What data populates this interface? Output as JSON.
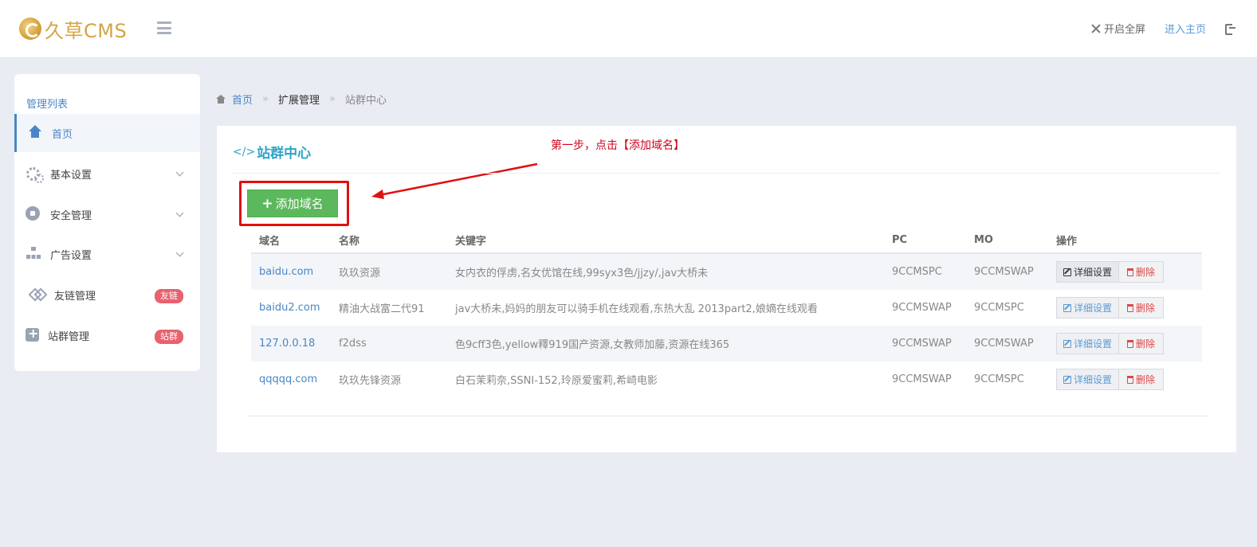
{
  "header": {
    "logo_text": "久草CMS",
    "fullscreen_label": "开启全屏",
    "home_link_label": "进入主页"
  },
  "sidebar": {
    "title": "管理列表",
    "items": [
      {
        "label": "首页",
        "icon": "home-icon",
        "active": true
      },
      {
        "label": "基本设置",
        "icon": "gears-icon",
        "chevron": true
      },
      {
        "label": "安全管理",
        "icon": "lock-icon",
        "chevron": true
      },
      {
        "label": "广告设置",
        "icon": "sitemap-icon",
        "chevron": true
      },
      {
        "label": "友链管理",
        "icon": "link-icon",
        "badge": "友链"
      },
      {
        "label": "站群管理",
        "icon": "plus-square-icon",
        "badge": "站群"
      }
    ]
  },
  "breadcrumb": {
    "home": "首页",
    "middle": "扩展管理",
    "current": "站群中心",
    "separator": "»"
  },
  "panel": {
    "title": "站群中心",
    "annotation": "第一步，点击【添加域名】",
    "add_button_label": "添加域名"
  },
  "table": {
    "headers": [
      "域名",
      "名称",
      "关键字",
      "PC",
      "MO",
      "操作"
    ],
    "rows": [
      {
        "domain": "baidu.com",
        "name": "玖玖资源",
        "keywords": "女内衣的俘虏,名女优馆在线,99syx3色/jjzy/,jav大桥未",
        "pc": "9CCMSPC",
        "mo": "9CCMSWAP"
      },
      {
        "domain": "baidu2.com",
        "name": "精油大战富二代91",
        "keywords": "jav大桥未,妈妈的朋友可以骑手机在线观看,东热大乱 2013part2,娘嫡在线观看",
        "pc": "9CCMSWAP",
        "mo": "9CCMSPC"
      },
      {
        "domain": "127.0.0.18",
        "name": "f2dss",
        "keywords": "色9cff3色,yellow釋919国产资源,女教师加藤,资源在线365",
        "pc": "9CCMSWAP",
        "mo": "9CCMSWAP"
      },
      {
        "domain": "qqqqq.com",
        "name": "玖玖先锋资源",
        "keywords": "白石茉莉奈,SSNI-152,玲原爱蜜莉,希崎电影",
        "pc": "9CCMSWAP",
        "mo": "9CCMSPC"
      }
    ],
    "edit_label": "详细设置",
    "delete_label": "删除"
  },
  "colors": {
    "accent_blue": "#4a86c5",
    "title_teal": "#2ea5c6",
    "add_green": "#5cb85c",
    "annotation_red": "#d0021b",
    "badge_red": "#e8616f"
  }
}
